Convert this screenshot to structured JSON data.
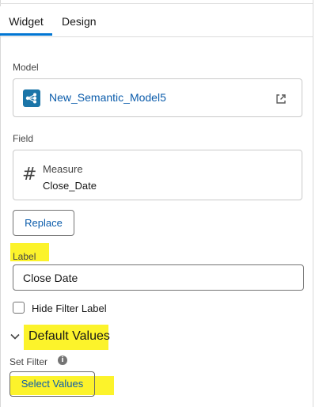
{
  "tabs": [
    {
      "label": "Widget",
      "active": true
    },
    {
      "label": "Design",
      "active": false
    }
  ],
  "model": {
    "label": "Model",
    "name": "New_Semantic_Model5",
    "icon": "semantic-model-icon",
    "open_icon": "external-link-icon"
  },
  "field": {
    "label": "Field",
    "type": "Measure",
    "name": "Close_Date",
    "icon": "hash-icon"
  },
  "replace_button": "Replace",
  "label_section": {
    "label": "Label",
    "value": "Close Date"
  },
  "hide_filter_label": {
    "label": "Hide Filter Label",
    "checked": false
  },
  "default_values": {
    "title": "Default Values",
    "expanded": true
  },
  "set_filter": {
    "label": "Set Filter",
    "info_icon": "i",
    "button": "Select Values"
  },
  "colors": {
    "accent": "#0176d3",
    "link": "#0b5cab",
    "highlight": "#fcf32b",
    "model_icon_bg": "#1b75a8"
  }
}
